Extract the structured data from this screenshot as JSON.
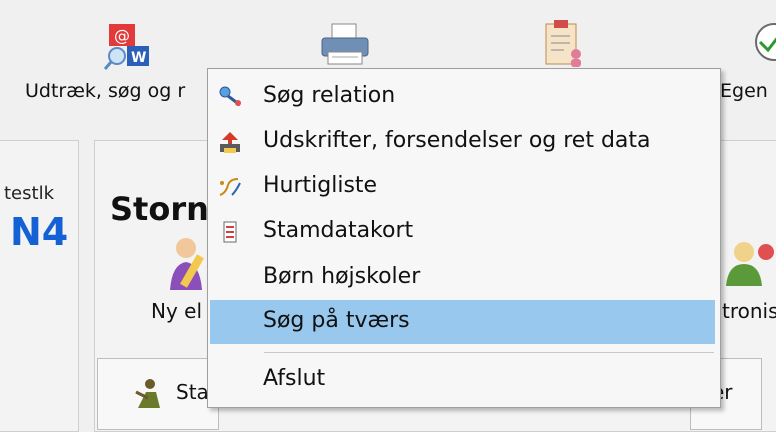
{
  "toolbar": {
    "items": [
      {
        "label": "Udtræk, søg og r",
        "icon": "mail-word-icon"
      },
      {
        "label": "",
        "icon": "printer-icon"
      },
      {
        "label": "",
        "icon": "clipboard-person-icon"
      },
      {
        "label": "Egen",
        "icon": "checkmark-icon"
      }
    ]
  },
  "left": {
    "user": "testlk",
    "code": "N4"
  },
  "center": {
    "title": "Storn",
    "buttons": [
      {
        "label": "Ny el",
        "icon": "pencil-person-icon"
      },
      {
        "label": "tronise",
        "icon": "person-sync-icon"
      }
    ]
  },
  "tabs": [
    {
      "label": "Sta",
      "icon": "person-icon"
    },
    {
      "label": "er",
      "icon": ""
    }
  ],
  "menu": {
    "items": [
      {
        "label": "Søg relation",
        "icon": "search-relation-icon"
      },
      {
        "label": "Udskrifter, forsendelser og ret data",
        "icon": "print-send-icon"
      },
      {
        "label": "Hurtigliste",
        "icon": "quicklist-icon"
      },
      {
        "label": "Stamdatakort",
        "icon": "card-icon"
      },
      {
        "label": "Børn højskoler",
        "icon": ""
      },
      {
        "label": "Søg på tværs",
        "icon": ""
      },
      {
        "label": "Afslut",
        "icon": ""
      }
    ],
    "selected_index": 5
  },
  "colors": {
    "menu_highlight": "#99c8ee",
    "code_blue": "#1461d6",
    "background": "#f0f0f0"
  }
}
